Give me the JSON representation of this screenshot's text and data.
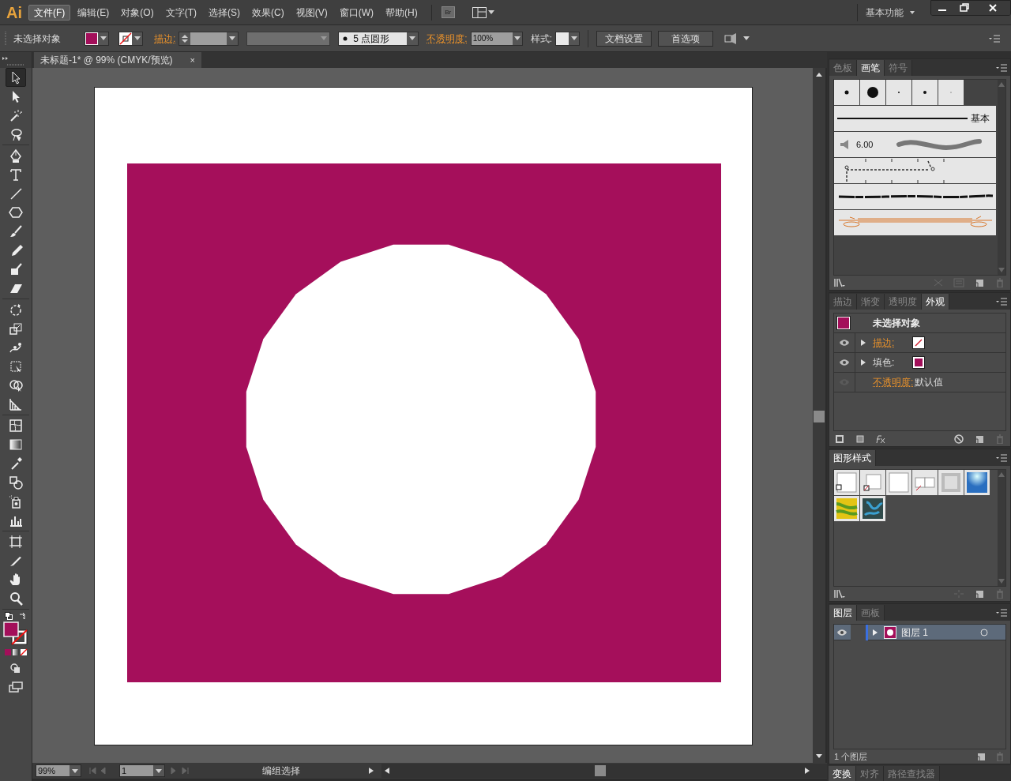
{
  "app": {
    "logo": "Ai"
  },
  "menu": [
    {
      "label": "文件(F)",
      "selected": true
    },
    {
      "label": "编辑(E)",
      "selected": false
    },
    {
      "label": "对象(O)",
      "selected": false
    },
    {
      "label": "文字(T)",
      "selected": false
    },
    {
      "label": "选择(S)",
      "selected": false
    },
    {
      "label": "效果(C)",
      "selected": false
    },
    {
      "label": "视图(V)",
      "selected": false
    },
    {
      "label": "窗口(W)",
      "selected": false
    },
    {
      "label": "帮助(H)",
      "selected": false
    }
  ],
  "bridge_button": "Br",
  "workspace": "基本功能",
  "control_bar": {
    "selection": "未选择对象",
    "stroke_label": "描边:",
    "brush": "5 点圆形",
    "opacity_label": "不透明度:",
    "opacity": "100%",
    "style_label": "样式:",
    "buttons": [
      "文档设置",
      "首选项"
    ]
  },
  "document_tab": {
    "title": "未标题-1* @ 99% (CMYK/预览)",
    "close": "×"
  },
  "tools": [
    {
      "kind": "selection",
      "selected": true
    },
    {
      "kind": "direct",
      "selected": false
    },
    {
      "kind": "wand",
      "selected": false
    },
    {
      "kind": "lasso",
      "selected": false
    },
    {
      "kind": "pen",
      "selected": false
    },
    {
      "kind": "type",
      "selected": false
    },
    {
      "kind": "line",
      "selected": false
    },
    {
      "kind": "polygon",
      "selected": false
    },
    {
      "kind": "brush",
      "selected": false
    },
    {
      "kind": "pencil",
      "selected": false
    },
    {
      "kind": "blob",
      "selected": false
    },
    {
      "kind": "eraser",
      "selected": false
    },
    {
      "kind": "rotate",
      "selected": false
    },
    {
      "kind": "scale",
      "selected": false
    },
    {
      "kind": "warp",
      "selected": false
    },
    {
      "kind": "transform",
      "selected": false
    },
    {
      "kind": "builder",
      "selected": false
    },
    {
      "kind": "perspective",
      "selected": false
    },
    {
      "kind": "mesh",
      "selected": false
    },
    {
      "kind": "gradient",
      "selected": false
    },
    {
      "kind": "eyedropper",
      "selected": false
    },
    {
      "kind": "blend",
      "selected": false
    },
    {
      "kind": "sprayer",
      "selected": false
    },
    {
      "kind": "graph",
      "selected": false
    },
    {
      "kind": "artboard",
      "selected": false
    },
    {
      "kind": "knife",
      "selected": false
    },
    {
      "kind": "hand",
      "selected": false
    },
    {
      "kind": "zoom",
      "selected": false
    }
  ],
  "brushes_panel": {
    "tabs": [
      {
        "label": "色板",
        "selected": false
      },
      {
        "label": "画笔",
        "selected": true
      },
      {
        "label": "符号",
        "selected": false
      }
    ],
    "basic_label": "基本",
    "calligraphic_size": "6.00"
  },
  "appearance_panel": {
    "tabs": [
      {
        "label": "描边",
        "selected": false
      },
      {
        "label": "渐变",
        "selected": false
      },
      {
        "label": "透明度",
        "selected": false
      },
      {
        "label": "外观",
        "selected": true
      }
    ],
    "title": "未选择对象",
    "rows": [
      {
        "kind": "stroke",
        "label": "描边:",
        "visible": true
      },
      {
        "kind": "fill",
        "label": "填色:",
        "visible": true
      },
      {
        "kind": "opacity",
        "label": "不透明度:",
        "value": "默认值",
        "visible": false
      }
    ]
  },
  "graphic_styles_panel": {
    "tabs": [
      {
        "label": "图形样式",
        "selected": true
      }
    ]
  },
  "layers_panel": {
    "tabs": [
      {
        "label": "图层",
        "selected": true
      },
      {
        "label": "画板",
        "selected": false
      }
    ],
    "layers": [
      {
        "name": "图层 1",
        "visible": true
      }
    ],
    "count": "1 个图层"
  },
  "bottom_tabs": [
    {
      "label": "变换",
      "selected": true
    },
    {
      "label": "对齐",
      "selected": false
    },
    {
      "label": "路径查找器",
      "selected": false
    }
  ],
  "status_bar": {
    "zoom": "99%",
    "artboard": "1",
    "tool": "编组选择"
  }
}
